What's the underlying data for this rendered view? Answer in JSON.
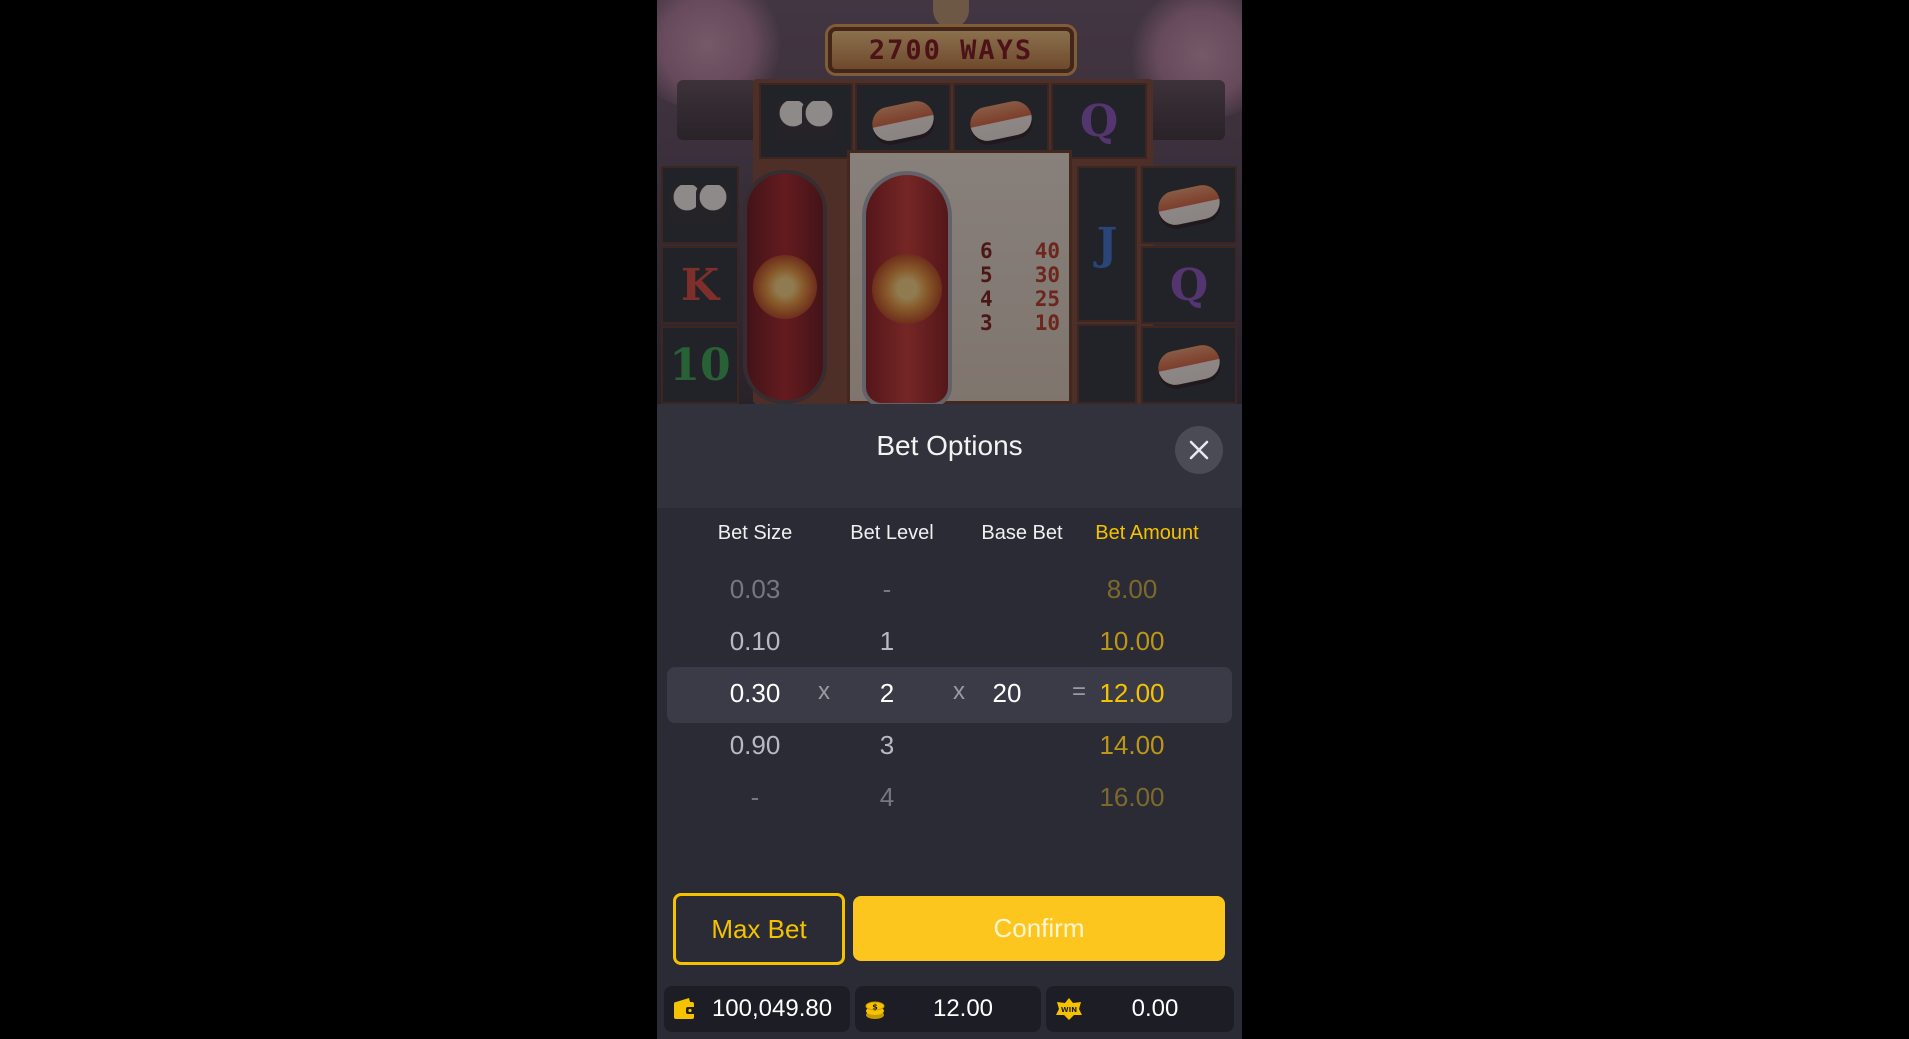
{
  "scene": {
    "ways_banner": "2700 WAYS",
    "paytable": [
      {
        "count": "6",
        "payout": "40"
      },
      {
        "count": "5",
        "payout": "30"
      },
      {
        "count": "4",
        "payout": "25"
      },
      {
        "count": "3",
        "payout": "10"
      }
    ],
    "symbols": {
      "k": "K",
      "ten": "10",
      "q": "Q",
      "j": "J"
    }
  },
  "bet_options": {
    "title": "Bet Options",
    "headers": {
      "bet_size": "Bet Size",
      "bet_level": "Bet Level",
      "base_bet": "Base Bet",
      "bet_amount": "Bet Amount"
    },
    "rows": [
      {
        "bet_size": "0.03",
        "bet_level": "-",
        "bet_amount": "8.00"
      },
      {
        "bet_size": "0.10",
        "bet_level": "1",
        "bet_amount": "10.00"
      },
      {
        "bet_size": "0.30",
        "bet_level": "2",
        "base_bet": "20",
        "bet_amount": "12.00"
      },
      {
        "bet_size": "0.90",
        "bet_level": "3",
        "bet_amount": "14.00"
      },
      {
        "bet_size": "-",
        "bet_level": "4",
        "bet_amount": "16.00"
      }
    ],
    "operators": {
      "multiply": "x",
      "equals": "="
    },
    "max_bet_label": "Max Bet",
    "confirm_label": "Confirm"
  },
  "status": {
    "balance": "100,049.80",
    "bet": "12.00",
    "win": "0.00",
    "win_icon_text": "WIN"
  },
  "colors": {
    "accent": "#f5c200",
    "panel": "#2a2b34",
    "header": "#31323c"
  }
}
